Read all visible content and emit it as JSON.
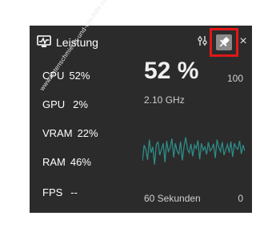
{
  "header": {
    "title": "Leistung",
    "close_glyph": "×"
  },
  "metrics": [
    {
      "label": "CPU",
      "value": "52%"
    },
    {
      "label": "GPU",
      "value": "2%"
    },
    {
      "label": "VRAM",
      "value": "22%"
    },
    {
      "label": "RAM",
      "value": "46%"
    },
    {
      "label": "FPS",
      "value": "--"
    }
  ],
  "detail": {
    "value": "52 %",
    "frequency": "2.10 GHz",
    "scale_max": "100",
    "scale_min": "0",
    "time_window": "60 Sekunden"
  },
  "graph": {
    "color": "#2e8b87",
    "samples": [
      28,
      55,
      47,
      30,
      64,
      42,
      52,
      22,
      56,
      60,
      38,
      48,
      58,
      26,
      62,
      44,
      50,
      66,
      34,
      58,
      45,
      40,
      61,
      29,
      53,
      68,
      48,
      42,
      57,
      36,
      55,
      49,
      63,
      31,
      58,
      46,
      52,
      39,
      60,
      45,
      49,
      57,
      33,
      64,
      51,
      44,
      60,
      38,
      47,
      56,
      42,
      61,
      35,
      58,
      50,
      48,
      62,
      40,
      55,
      45
    ]
  },
  "watermark": {
    "text": "www.tintenschmierer-und-win-hilfe.com"
  },
  "colors": {
    "panel": "#2b2b2b",
    "highlight": "#e01818",
    "accent": "#2e8b87"
  },
  "icons": {
    "title": "performance-monitor-icon",
    "options": "options-icon",
    "pin": "pin-icon",
    "close": "close-icon"
  }
}
